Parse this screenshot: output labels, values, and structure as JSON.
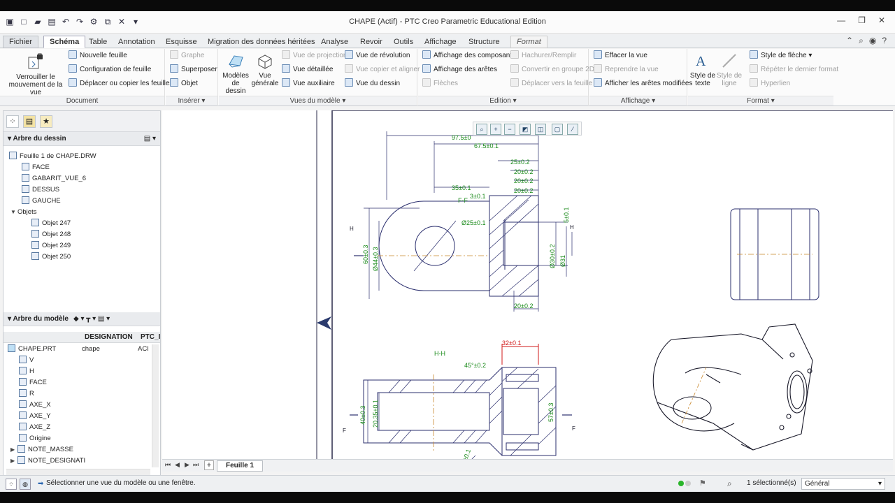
{
  "window": {
    "title": "CHAPE (Actif) - PTC Creo Parametric Educational Edition"
  },
  "tabs": [
    {
      "label": "Fichier",
      "kind": "file"
    },
    {
      "label": "Schéma",
      "kind": "active"
    },
    {
      "label": "Table"
    },
    {
      "label": "Annotation"
    },
    {
      "label": "Esquisse"
    },
    {
      "label": "Migration des données héritées"
    },
    {
      "label": "Analyse"
    },
    {
      "label": "Revoir"
    },
    {
      "label": "Outils"
    },
    {
      "label": "Affichage"
    },
    {
      "label": "Structure"
    },
    {
      "label": "Format",
      "kind": "fmt"
    }
  ],
  "ribbon": {
    "document": {
      "label": "Document",
      "lock_btn": [
        "Verrouiller le",
        "mouvement de la vue"
      ],
      "new_sheet": "Nouvelle feuille",
      "sheet_config": "Configuration de feuille",
      "move_sheets": "Déplacer ou copier les feuilles"
    },
    "inserer": {
      "label": "Insérer",
      "graphe": "Graphe",
      "superposer": "Superposer",
      "objet": "Objet"
    },
    "vues": {
      "label": "Vues du modèle",
      "modeles": [
        "Modèles",
        "de dessin"
      ],
      "vue_generale": [
        "Vue",
        "générale"
      ],
      "projection": "Vue de projection",
      "detaillee": "Vue détaillée",
      "auxiliaire": "Vue auxiliaire",
      "revolution": "Vue de révolution",
      "copier": "Vue copier et aligner",
      "dessin": "Vue du dessin"
    },
    "edition": {
      "label": "Edition",
      "composants": "Affichage des composants",
      "aretes": "Affichage des arêtes",
      "fleches": "Flèches",
      "hachurer": "Hachurer/Remplir",
      "convertir": "Convertir en groupe 2D",
      "deplacer": "Déplacer vers la feuille"
    },
    "affichage": {
      "label": "Affichage",
      "effacer": "Effacer la vue",
      "reprendre": "Reprendre la vue",
      "afficher": "Afficher les arêtes modifiées"
    },
    "format": {
      "label": "Format",
      "style_texte": [
        "Style de",
        "texte"
      ],
      "style_ligne": [
        "Style de",
        "ligne"
      ],
      "style_fleche": "Style de flèche",
      "repeter": "Répéter le dernier format",
      "hyperlien": "Hyperlien"
    }
  },
  "drawing_tree": {
    "title": "Arbre du dessin",
    "items": [
      {
        "label": "Feuille 1 de CHAPE.DRW"
      },
      {
        "label": "FACE"
      },
      {
        "label": "GABARIT_VUE_6"
      },
      {
        "label": "DESSUS"
      },
      {
        "label": "GAUCHE"
      },
      {
        "label": "Objets"
      },
      {
        "label": "Objet 247"
      },
      {
        "label": "Objet 248"
      },
      {
        "label": "Objet 249"
      },
      {
        "label": "Objet 250"
      }
    ]
  },
  "model_tree": {
    "title": "Arbre du modèle",
    "col_designation": "DESIGNATION",
    "col_ptc": "PTC_I",
    "rows": [
      {
        "name": "CHAPE.PRT",
        "designation": "chape",
        "ptc": "ACI"
      },
      {
        "name": "V"
      },
      {
        "name": "H"
      },
      {
        "name": "FACE"
      },
      {
        "name": "R"
      },
      {
        "name": "AXE_X"
      },
      {
        "name": "AXE_Y"
      },
      {
        "name": "AXE_Z"
      },
      {
        "name": "Origine"
      },
      {
        "name": "NOTE_MASSE"
      },
      {
        "name": "NOTE_DESIGNATI"
      }
    ]
  },
  "sheet": {
    "tab": "Feuille 1"
  },
  "status": {
    "message": "Sélectionner une vue du modèle ou une fenêtre.",
    "selected": "1 sélectionné(s)",
    "filter": "Général"
  },
  "drawing": {
    "dims": {
      "d97": "97.5±0",
      "d67": "67.5±0.1",
      "d25": "25±0.2",
      "d20a": "20±0.2",
      "d20b": "20±0.2",
      "d20c": "20±0.2",
      "d35": "35±0.1",
      "d3": "3±0.1",
      "ff": "F-F",
      "phi25": "Ø25±0.1",
      "d60": "60±0.3",
      "phi44": "Ø44±0.3",
      "phi30": "Ø30±0.2",
      "phi31": "Ø31",
      "d20bot": "20±0.2",
      "hh": "H-H",
      "d32": "32±0.1",
      "d45": "45°±0.2",
      "d40": "40±0.3",
      "d2035": "20.35±0.1",
      "d57": "57±0.3",
      "h": "H",
      "f": "F",
      "d5": "5±0.1",
      "d10": "10±0.1"
    }
  }
}
